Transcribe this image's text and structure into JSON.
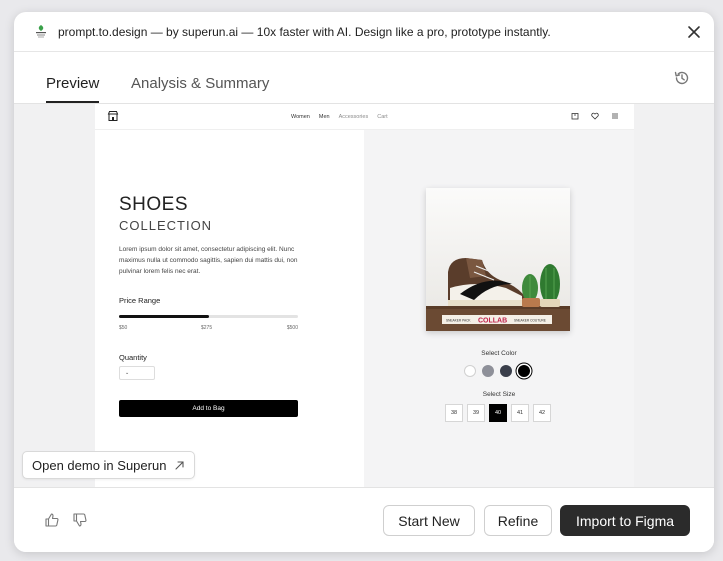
{
  "dialog": {
    "title": "prompt.to.design — by superun.ai — 10x faster with AI. Design like a pro, prototype instantly."
  },
  "tabs": [
    {
      "label": "Preview",
      "active": true
    },
    {
      "label": "Analysis & Summary",
      "active": false
    }
  ],
  "preview": {
    "nav": {
      "links": [
        "Women",
        "Men",
        "Accessories",
        "Cart"
      ]
    },
    "hero": {
      "title": "SHOES",
      "subtitle": "COLLECTION",
      "description": "Lorem ipsum dolor sit amet, consectetur adipiscing elit. Nunc maximus nulla ut commodo sagittis, sapien dui mattis dui, non pulvinar lorem felis nec erat."
    },
    "price": {
      "label": "Price Range",
      "min": "$50",
      "current": "$275",
      "max": "$500",
      "fill_fraction": 0.5
    },
    "quantity": {
      "label": "Quantity"
    },
    "add_to_bag": "Add to Bag",
    "product_image": {
      "banner_left": "SNEAKER PACK",
      "banner_main": "COLLAB",
      "banner_right": "SNEAKER COUTURE"
    },
    "color": {
      "label": "Select Color",
      "swatches": [
        "#ffffff",
        "#8e9099",
        "#3a3f4b",
        "#000000"
      ],
      "selected_index": 3
    },
    "size": {
      "label": "Select Size",
      "options": [
        "38",
        "39",
        "40",
        "41",
        "42"
      ],
      "selected": "40"
    }
  },
  "open_demo": {
    "label": "Open demo in Superun"
  },
  "footer": {
    "start_new": "Start New",
    "refine": "Refine",
    "import": "Import to Figma"
  },
  "colors": {
    "accent_dark": "#2b2b2b",
    "logo_green": "#3aa14a"
  }
}
